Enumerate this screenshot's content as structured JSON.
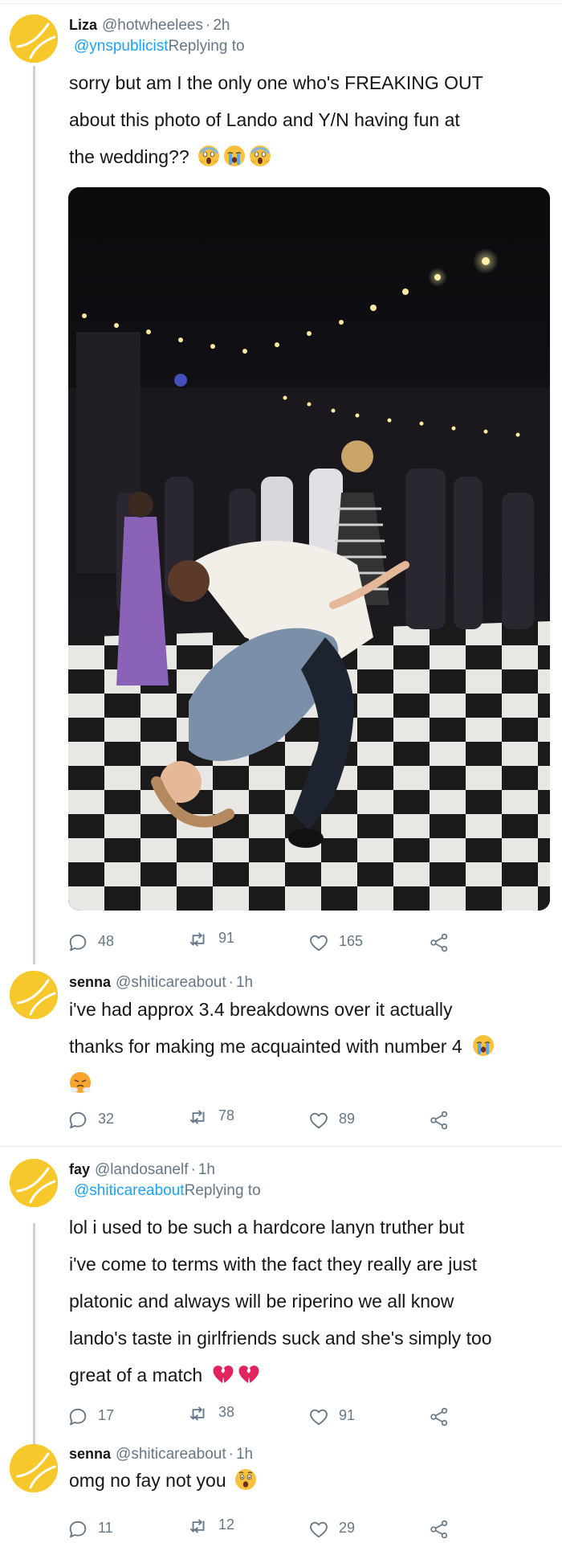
{
  "colors": {
    "link": "#1da1f2",
    "muted": "#657786",
    "avatar": "#f7c82b",
    "thread_line": "#c9d3db"
  },
  "tweets": [
    {
      "name": "Liza",
      "handle": "@hotwheelees",
      "time": "2h",
      "reply_to_handle": "@ynspublicist",
      "reply_to_label": "Replying to",
      "lines": [
        "sorry but am I the only one who's FREAKING OUT",
        "about this photo of Lando and Y/N having fun at",
        "the wedding??"
      ],
      "emojis": [
        "screaming-face-emoji",
        "crying-face-emoji",
        "screaming-face-emoji"
      ],
      "photo": "dance-floor-dip-photo",
      "replies": "48",
      "retweets": "91",
      "likes": "165"
    },
    {
      "name": "senna",
      "handle": "@shiticareabout",
      "time": "1h",
      "lines": [
        "i've had approx 3.4 breakdowns over it actually",
        "thanks for making me acquainted with number 4"
      ],
      "emojis": [
        "crying-face-emoji",
        "steaming-face-emoji"
      ],
      "replies": "32",
      "retweets": "78",
      "likes": "89"
    },
    {
      "name": "fay",
      "handle": "@landosanelf",
      "time": "1h",
      "reply_to_handle": "@shiticareabout",
      "reply_to_label": "Replying to",
      "lines": [
        "lol i used to be such a hardcore lanyn truther but",
        "i've come to terms with the fact they really are just",
        "platonic and always will be riperino we all know",
        "lando's taste in girlfriends suck and she's simply too",
        "great of a match"
      ],
      "emojis": [
        "broken-heart-emoji",
        "broken-heart-emoji"
      ],
      "replies": "17",
      "retweets": "38",
      "likes": "91"
    },
    {
      "name": "senna",
      "handle": "@shiticareabout",
      "time": "1h",
      "lines": [
        "omg no fay not you"
      ],
      "emojis": [
        "astonished-face-emoji"
      ],
      "replies": "11",
      "retweets": "12",
      "likes": "29"
    }
  ]
}
